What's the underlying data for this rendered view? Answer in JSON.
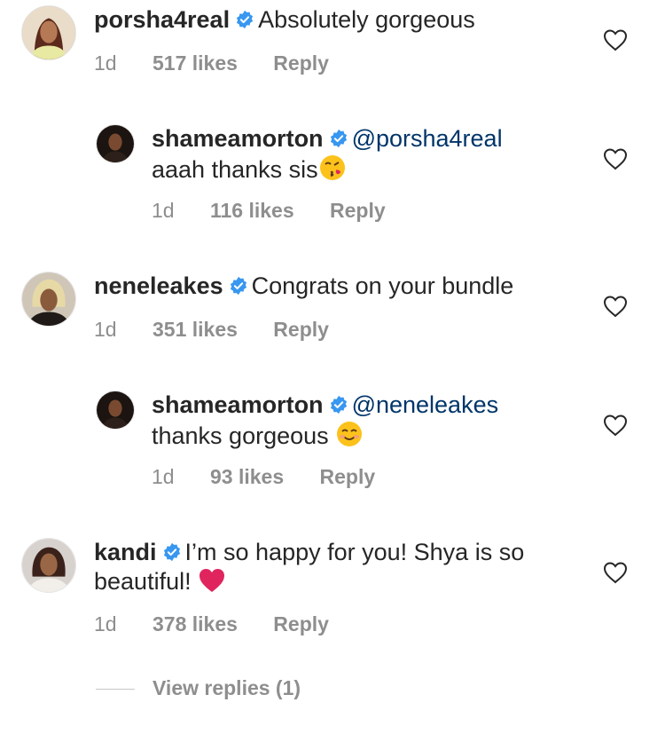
{
  "comments": [
    {
      "username": "porsha4real",
      "text": "Absolutely gorgeous",
      "time": "1d",
      "likes": "517 likes",
      "reply": "Reply"
    },
    {
      "username": "shameamorton",
      "mention": "@porsha4real",
      "text": "aaah thanks sis",
      "emoji": "kissing-face-emoji",
      "time": "1d",
      "likes": "116 likes",
      "reply": "Reply"
    },
    {
      "username": "neneleakes",
      "text": "Congrats on your bundle",
      "time": "1d",
      "likes": "351 likes",
      "reply": "Reply"
    },
    {
      "username": "shameamorton",
      "mention": "@neneleakes",
      "text": "thanks gorgeous",
      "emoji": "smiling-face-emoji",
      "time": "1d",
      "likes": "93 likes",
      "reply": "Reply"
    },
    {
      "username": "kandi",
      "text_line1": "I’m so happy for you! Shya is so",
      "text_line2": "beautiful!",
      "emoji": "red-heart-emoji",
      "time": "1d",
      "likes": "378 likes",
      "reply": "Reply"
    }
  ],
  "view_replies": "View replies (1)",
  "colors": {
    "text": "#262626",
    "meta": "#8e8e8e",
    "mention": "#003569",
    "verified": "#3897f0"
  }
}
